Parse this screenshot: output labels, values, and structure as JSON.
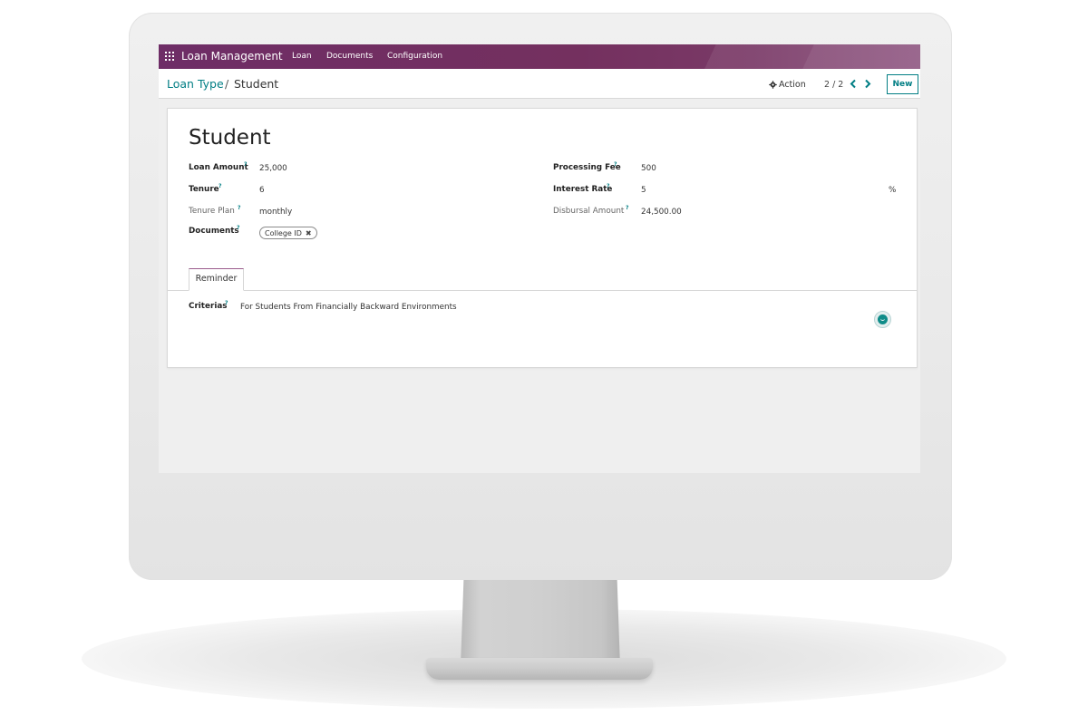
{
  "navbar": {
    "app_name": "Loan Management",
    "menu": [
      "Loan",
      "Documents",
      "Configuration"
    ],
    "bg_color": "#74305f"
  },
  "breadcrumb": {
    "parent": "Loan Type",
    "separator": "/",
    "current": "Student"
  },
  "toolbar": {
    "action_label": "Action",
    "pager": "2 / 2",
    "new_label": "New",
    "accent": "#017e84"
  },
  "form": {
    "title": "Student",
    "fields": {
      "loan_amount": {
        "label": "Loan Amount",
        "value": "25,000"
      },
      "tenure": {
        "label": "Tenure",
        "value": "6"
      },
      "tenure_plan": {
        "label": "Tenure Plan",
        "value": "monthly"
      },
      "documents": {
        "label": "Documents",
        "tag": "College ID"
      },
      "processing_fee": {
        "label": "Processing Fee",
        "value": "500"
      },
      "interest_rate": {
        "label": "Interest Rate",
        "value": "5",
        "unit": "%"
      },
      "disbursal_amount": {
        "label": "Disbursal Amount",
        "value": "24,500.00"
      }
    },
    "help_mark": "?",
    "tabs": [
      "Reminder"
    ],
    "criterias": {
      "label": "Criterias",
      "value": "For Students From Financially Backward Environments"
    }
  }
}
